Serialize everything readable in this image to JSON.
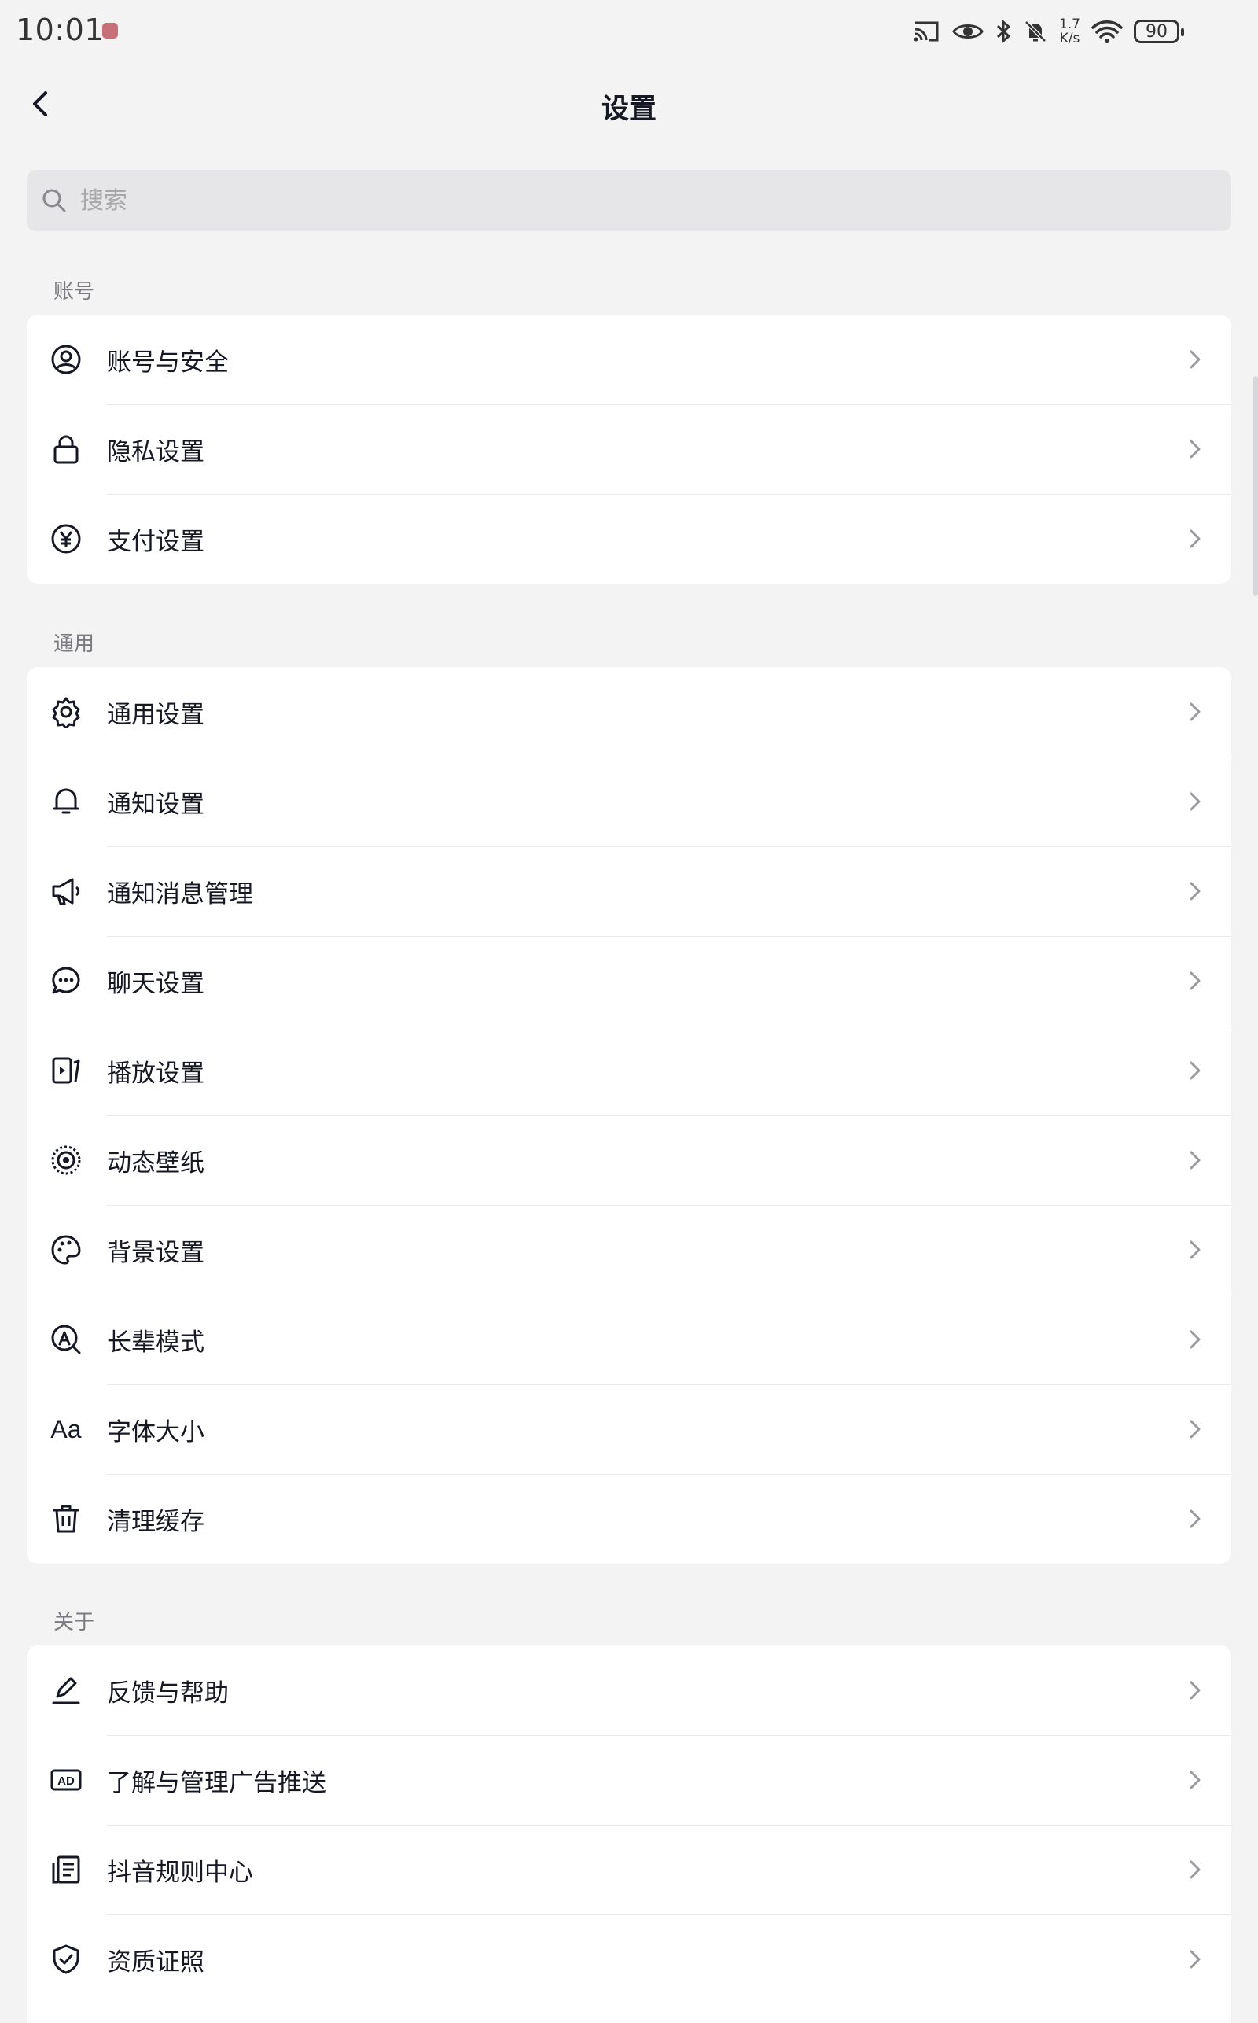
{
  "status_bar": {
    "time": "10:01",
    "net_speed_value": "1.7",
    "net_speed_unit": "K/s",
    "battery": "90"
  },
  "header": {
    "title": "设置"
  },
  "search": {
    "placeholder": "搜索"
  },
  "sections": [
    {
      "label": "账号",
      "items": [
        {
          "label": "账号与安全",
          "icon": "user-circle-icon"
        },
        {
          "label": "隐私设置",
          "icon": "lock-icon"
        },
        {
          "label": "支付设置",
          "icon": "yuan-icon"
        }
      ]
    },
    {
      "label": "通用",
      "items": [
        {
          "label": "通用设置",
          "icon": "gear-icon"
        },
        {
          "label": "通知设置",
          "icon": "bell-icon"
        },
        {
          "label": "通知消息管理",
          "icon": "megaphone-icon"
        },
        {
          "label": "聊天设置",
          "icon": "chat-bubble-icon"
        },
        {
          "label": "播放设置",
          "icon": "play-screen-icon"
        },
        {
          "label": "动态壁纸",
          "icon": "wallpaper-target-icon"
        },
        {
          "label": "背景设置",
          "icon": "palette-icon"
        },
        {
          "label": "长辈模式",
          "icon": "elder-mode-icon"
        },
        {
          "label": "字体大小",
          "icon": "font-size-icon",
          "icon_text": "Aa"
        },
        {
          "label": "清理缓存",
          "icon": "trash-icon"
        }
      ]
    },
    {
      "label": "关于",
      "items": [
        {
          "label": "反馈与帮助",
          "icon": "pen-icon"
        },
        {
          "label": "了解与管理广告推送",
          "icon": "ad-icon",
          "icon_text": "AD"
        },
        {
          "label": "抖音规则中心",
          "icon": "document-list-icon"
        },
        {
          "label": "资质证照",
          "icon": "shield-check-icon"
        }
      ]
    }
  ],
  "colors": {
    "background": "#f3f3f3",
    "card": "#ffffff",
    "text": "#161823",
    "secondary": "#7a7a80"
  }
}
